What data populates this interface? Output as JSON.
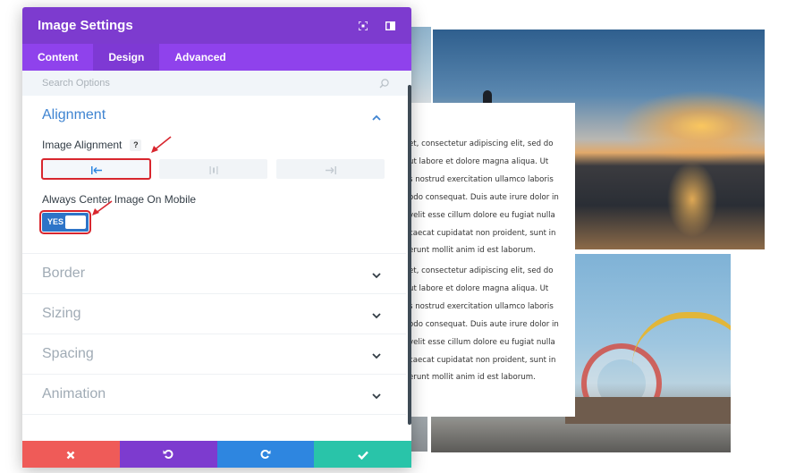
{
  "modal": {
    "title": "Image Settings",
    "tabs": [
      {
        "label": "Content"
      },
      {
        "label": "Design"
      },
      {
        "label": "Advanced"
      }
    ],
    "active_tab": "Design",
    "search": {
      "placeholder": "Search Options",
      "value": ""
    }
  },
  "sections": {
    "alignment": {
      "title": "Alignment",
      "expanded": true,
      "image_alignment": {
        "label": "Image Alignment",
        "help": "?",
        "options": [
          "left-align-icon",
          "center-align-icon",
          "right-align-icon"
        ],
        "selected": "left"
      },
      "center_on_mobile": {
        "label": "Always Center Image On Mobile",
        "toggle_text": "YES",
        "enabled": true
      }
    },
    "border": {
      "title": "Border"
    },
    "sizing": {
      "title": "Sizing"
    },
    "spacing": {
      "title": "Spacing"
    },
    "animation": {
      "title": "Animation"
    }
  },
  "footer": {
    "buttons": [
      "close-icon",
      "undo-icon",
      "redo-icon",
      "check-icon"
    ]
  },
  "background_page": {
    "text_block_1": [
      "et, consectetur adipiscing elit, sed do",
      "ut labore et dolore magna aliqua. Ut",
      "s nostrud exercitation ullamco laboris",
      "odo consequat. Duis aute irure dolor in",
      "velit esse cillum dolore eu fugiat nulla",
      "caecat cupidatat non proident, sunt in",
      "erunt mollit anim id est laborum."
    ],
    "text_block_2": [
      "et, consectetur adipiscing elit, sed do",
      "ut labore et dolore magna aliqua. Ut",
      "s nostrud exercitation ullamco laboris",
      "odo consequat. Duis aute irure dolor in",
      "velit esse cillum dolore eu fugiat nulla",
      "caecat cupidatat non proident, sunt in",
      "erunt mollit anim id est laborum."
    ]
  },
  "colors": {
    "header": "#7d3bcf",
    "tabs": "#8f42ec",
    "open_section": "#3f84d1",
    "toggle_on": "#2d74c8",
    "highlight": "#d8262e",
    "cancel": "#ef5b58",
    "undo": "#7d3bcf",
    "redo": "#2e86e0",
    "save": "#29c4a9"
  }
}
